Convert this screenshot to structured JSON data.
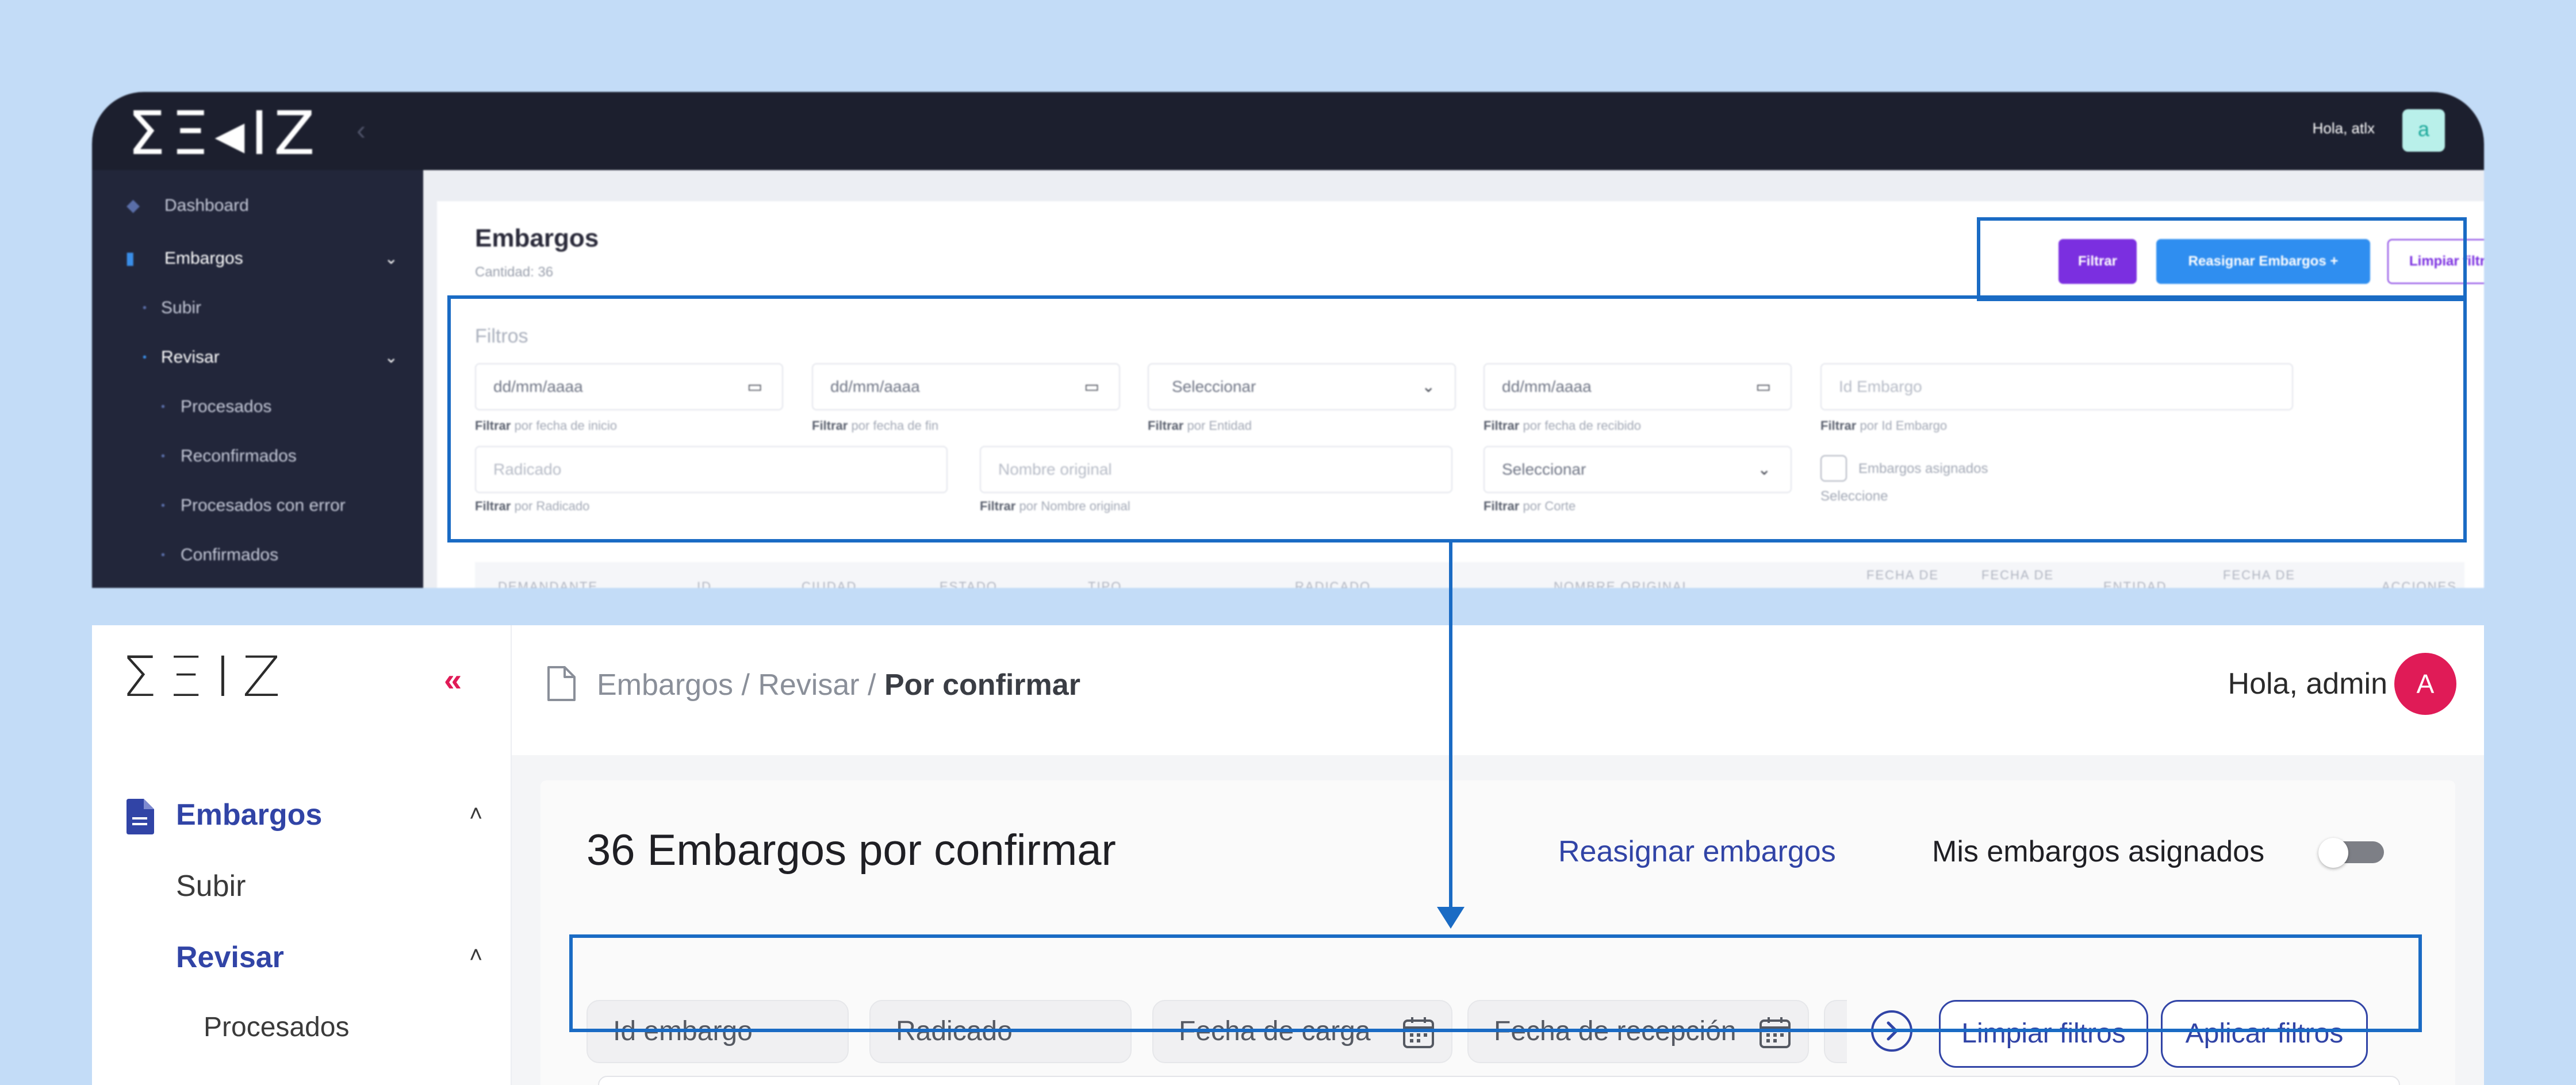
{
  "old_ui": {
    "logo": "ΣΞ◂IZ",
    "collapse_icon": "chevron-left-icon",
    "greeting": "Hola, atlx",
    "avatar_letter": "a",
    "sidebar": {
      "dashboard": "Dashboard",
      "embargos": "Embargos",
      "subir": "Subir",
      "revisar": "Revisar",
      "procesados": "Procesados",
      "reconfirmados": "Reconfirmados",
      "procesados_error": "Procesados con error",
      "confirmados": "Confirmados"
    },
    "title": "Embargos",
    "count": "Cantidad: 36",
    "buttons": {
      "filtrar": "Filtrar",
      "reasignar": "Reasignar Embargos +",
      "limpiar": "Limpiar filtros"
    },
    "filters_label": "Filtros",
    "filters": {
      "fecha_inicio": {
        "value": "dd/mm/aaaa",
        "help_prefix": "Filtrar",
        "help": " por fecha de inicio"
      },
      "fecha_fin": {
        "value": "dd/mm/aaaa",
        "help_prefix": "Filtrar",
        "help": " por fecha de fin"
      },
      "entidad": {
        "value": "Seleccionar",
        "help_prefix": "Filtrar",
        "help": " por Entidad"
      },
      "fecha_recibido": {
        "value": "dd/mm/aaaa",
        "help_prefix": "Filtrar",
        "help": " por fecha de recibido"
      },
      "id_embargo": {
        "placeholder": "Id Embargo",
        "help_prefix": "Filtrar",
        "help": " por Id Embargo"
      },
      "radicado": {
        "placeholder": "Radicado",
        "help_prefix": "Filtrar",
        "help": " por Radicado"
      },
      "nombre_original": {
        "placeholder": "Nombre original",
        "help_prefix": "Filtrar",
        "help": " por Nombre original"
      },
      "corte": {
        "value": "Seleccionar",
        "help_prefix": "Filtrar",
        "help": " por Corte"
      },
      "asignados": {
        "label": "Embargos asignados",
        "help": "Seleccione"
      }
    },
    "table_headers": [
      "DEMANDANTE",
      "ID",
      "CIUDAD",
      "ESTADO",
      "TIPO",
      "RADICADO",
      "NOMBRE ORIGINAL",
      "FECHA DE",
      "FECHA DE",
      "ENTIDAD",
      "FECHA DE",
      "ACCIONES"
    ],
    "colors": {
      "filtrar": "#7b2fe0",
      "reasignar": "#2f8ef0",
      "limpiar": "#7b2fe0"
    }
  },
  "new_ui": {
    "logo": "ΣΞIZ",
    "collapse_icon": "double-chevron-left-icon",
    "breadcrumb": {
      "part1": "Embargos / Revisar / ",
      "current": "Por confirmar"
    },
    "greeting": "Hola, admin",
    "avatar_letter": "A",
    "sidebar": {
      "embargos": "Embargos",
      "subir": "Subir",
      "revisar": "Revisar",
      "procesados": "Procesados"
    },
    "title": "36 Embargos por confirmar",
    "reasignar_link": "Reasignar embargos",
    "toggle_label": "Mis embargos asignados",
    "toggle_on": false,
    "filters": {
      "id_embargo": "Id embargo",
      "radicado": "Radicado",
      "fecha_carga": "Fecha de carga",
      "fecha_recepcion": "Fecha de recepción"
    },
    "buttons": {
      "limpiar": "Limpiar filtros",
      "aplicar": "Aplicar filtros"
    },
    "colors": {
      "accent": "#3144a6",
      "brand": "#e01b57"
    }
  }
}
